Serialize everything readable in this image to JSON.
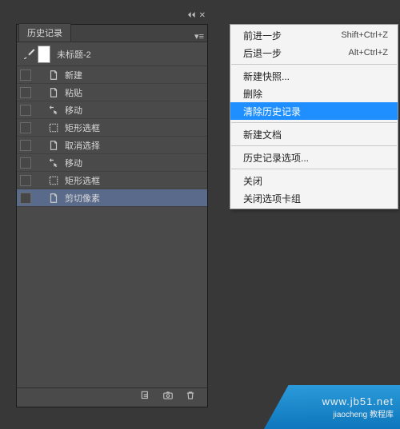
{
  "panel": {
    "tab_label": "历史记录",
    "snapshot_label": "未标题-2"
  },
  "history": [
    {
      "icon": "doc",
      "label": "新建",
      "sel": false
    },
    {
      "icon": "doc",
      "label": "粘贴",
      "sel": false
    },
    {
      "icon": "move",
      "label": "移动",
      "sel": false
    },
    {
      "icon": "marq",
      "label": "矩形选框",
      "sel": false
    },
    {
      "icon": "doc",
      "label": "取消选择",
      "sel": false
    },
    {
      "icon": "move",
      "label": "移动",
      "sel": false
    },
    {
      "icon": "marq",
      "label": "矩形选框",
      "sel": false
    },
    {
      "icon": "doc",
      "label": "剪切像素",
      "sel": true
    }
  ],
  "context_menu": [
    {
      "type": "item",
      "label": "前进一步",
      "shortcut": "Shift+Ctrl+Z",
      "hl": false
    },
    {
      "type": "item",
      "label": "后退一步",
      "shortcut": "Alt+Ctrl+Z",
      "hl": false
    },
    {
      "type": "sep"
    },
    {
      "type": "item",
      "label": "新建快照...",
      "shortcut": "",
      "hl": false
    },
    {
      "type": "item",
      "label": "删除",
      "shortcut": "",
      "hl": false
    },
    {
      "type": "item",
      "label": "清除历史记录",
      "shortcut": "",
      "hl": true
    },
    {
      "type": "sep"
    },
    {
      "type": "item",
      "label": "新建文档",
      "shortcut": "",
      "hl": false
    },
    {
      "type": "sep"
    },
    {
      "type": "item",
      "label": "历史记录选项...",
      "shortcut": "",
      "hl": false
    },
    {
      "type": "sep"
    },
    {
      "type": "item",
      "label": "关闭",
      "shortcut": "",
      "hl": false
    },
    {
      "type": "item",
      "label": "关闭选项卡组",
      "shortcut": "",
      "hl": false
    }
  ],
  "watermark": {
    "line1": "www.jb51.net",
    "line2": "jiaocheng 教程库"
  }
}
